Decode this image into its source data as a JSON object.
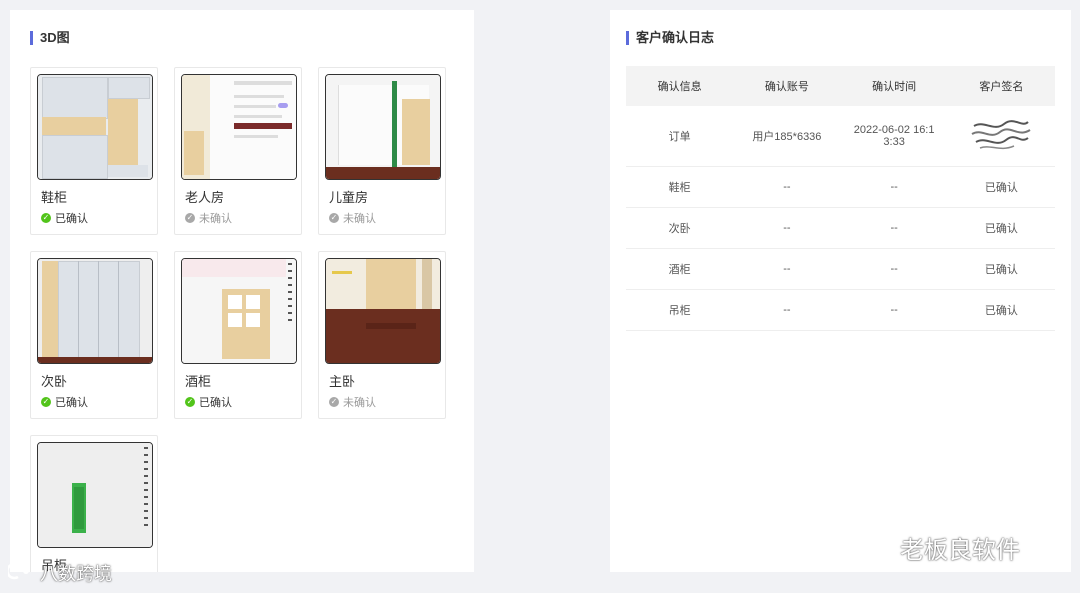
{
  "left": {
    "title": "3D图",
    "cards": [
      {
        "name": "鞋柜",
        "status": "已确认",
        "status_type": "confirmed"
      },
      {
        "name": "老人房",
        "status": "未确认",
        "status_type": "pending"
      },
      {
        "name": "儿童房",
        "status": "未确认",
        "status_type": "pending"
      },
      {
        "name": "次卧",
        "status": "已确认",
        "status_type": "confirmed"
      },
      {
        "name": "酒柜",
        "status": "已确认",
        "status_type": "confirmed"
      },
      {
        "name": "主卧",
        "status": "未确认",
        "status_type": "pending"
      },
      {
        "name": "吊柜",
        "status": "",
        "status_type": "none"
      }
    ]
  },
  "right": {
    "title": "客户确认日志",
    "columns": [
      "确认信息",
      "确认账号",
      "确认时间",
      "客户签名"
    ],
    "rows": [
      {
        "info": "订单",
        "account": "用户185*6336",
        "time": "2022-06-02 16:13:33",
        "time_line1": "2022-06-02 16:1",
        "time_line2": "3:33",
        "signature": "signature-image"
      },
      {
        "info": "鞋柜",
        "account": "--",
        "time": "--",
        "signature": "已确认"
      },
      {
        "info": "次卧",
        "account": "--",
        "time": "--",
        "signature": "已确认"
      },
      {
        "info": "酒柜",
        "account": "--",
        "time": "--",
        "signature": "已确认"
      },
      {
        "info": "吊柜",
        "account": "--",
        "time": "--",
        "signature": "已确认"
      }
    ]
  },
  "watermarks": {
    "right": "老板良软件",
    "left": "八数跨境"
  },
  "colors": {
    "accent": "#5c6bdb",
    "confirmed": "#52c41a",
    "pending": "#a8a8a8"
  }
}
